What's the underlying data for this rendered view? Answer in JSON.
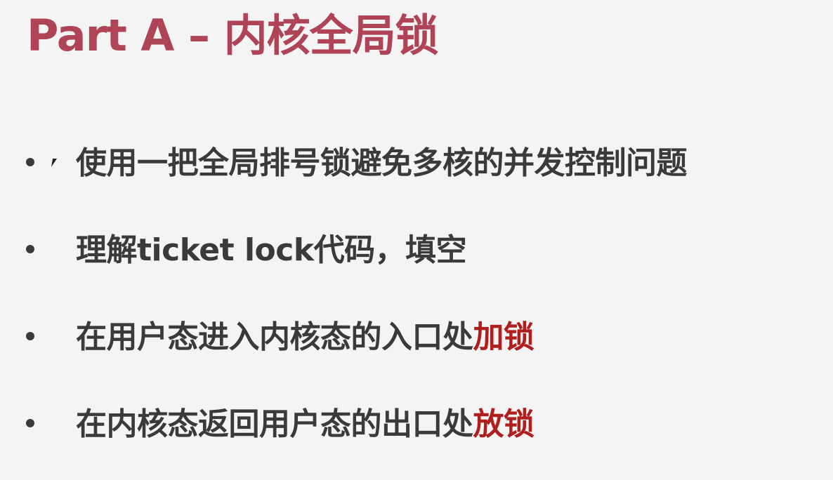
{
  "slide": {
    "title": "Part A – 内核全局锁",
    "bullets": [
      {
        "text": "使用一把全局排号锁避免多核的并发控制问题",
        "highlight": ""
      },
      {
        "text": "理解ticket lock代码，填空",
        "highlight": ""
      },
      {
        "text": "在用户态进入内核态的入口处",
        "highlight": "加锁"
      },
      {
        "text": "在内核态返回用户态的出口处",
        "highlight": "放锁"
      }
    ]
  },
  "colors": {
    "title": "#b04457",
    "body_text": "#3a3a3a",
    "highlight": "#b01e1e",
    "background": "#f4f4f4"
  }
}
